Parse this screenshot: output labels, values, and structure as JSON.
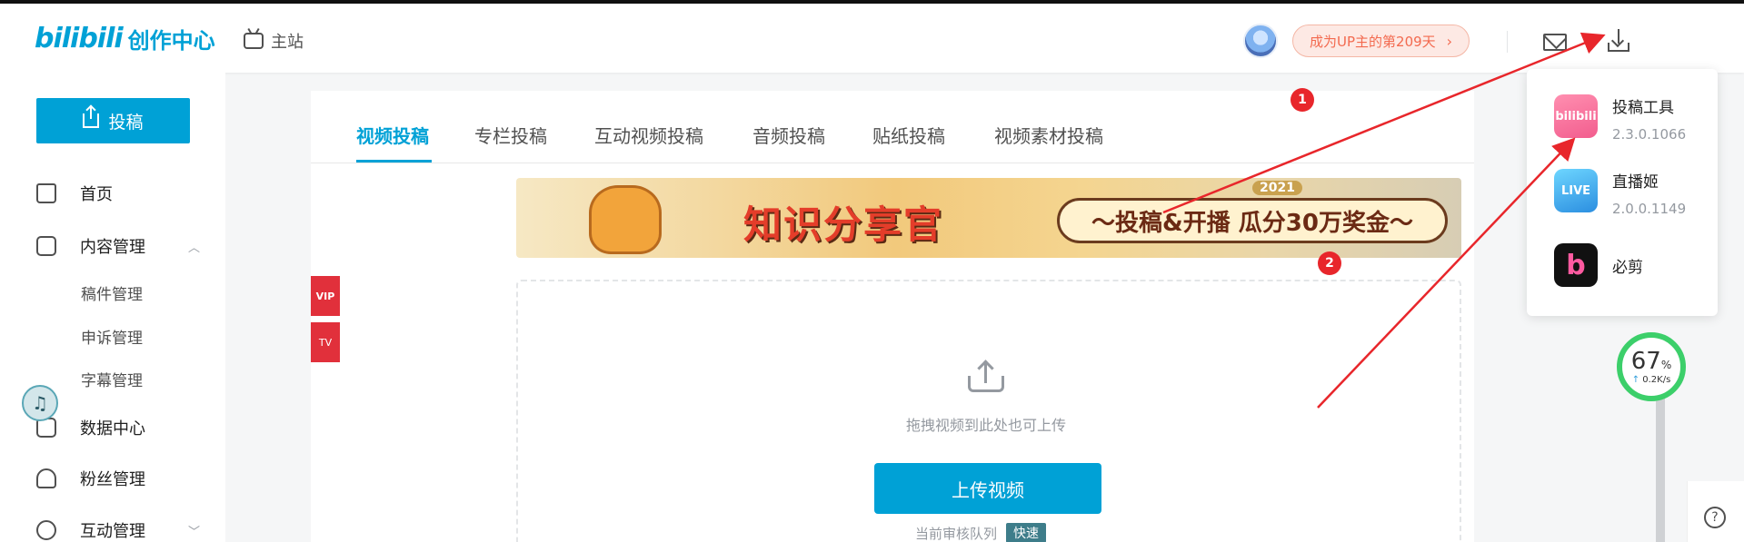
{
  "header": {
    "logo_text": "bilibili",
    "app_title": "创作中心",
    "home_link": "主站",
    "up_badge": "成为UP主的第209天"
  },
  "sidebar": {
    "upload_button": "投稿",
    "items": [
      {
        "label": "首页"
      },
      {
        "label": "内容管理"
      },
      {
        "label": "数据中心"
      },
      {
        "label": "粉丝管理"
      },
      {
        "label": "互动管理"
      }
    ],
    "sub_items": [
      {
        "label": "稿件管理"
      },
      {
        "label": "申诉管理"
      },
      {
        "label": "字幕管理"
      }
    ]
  },
  "tabs": [
    {
      "label": "视频投稿",
      "active": true
    },
    {
      "label": "专栏投稿"
    },
    {
      "label": "互动视频投稿"
    },
    {
      "label": "音频投稿"
    },
    {
      "label": "贴纸投稿"
    },
    {
      "label": "视频素材投稿"
    }
  ],
  "banner": {
    "title": "知识分享官",
    "slogan": "〜投稿&开播 瓜分30万奖金〜",
    "year": "2021"
  },
  "side_badges": {
    "vip": "VIP",
    "tv": "TV"
  },
  "upload_area": {
    "hint": "拖拽视频到此处也可上传",
    "button": "上传视频",
    "queue_label": "当前审核队列",
    "queue_status": "快速"
  },
  "download_menu": [
    {
      "name": "投稿工具",
      "version": "2.3.0.1066",
      "icon_text": "bilibili"
    },
    {
      "name": "直播姬",
      "version": "2.0.0.1149",
      "icon_text": "LIVE"
    },
    {
      "name": "必剪",
      "version": "",
      "icon_text": "b"
    }
  ],
  "speed_widget": {
    "percent": "67",
    "percent_unit": "%",
    "rate": "0.2K/s"
  },
  "annotations": {
    "dot1": "1",
    "dot2": "2",
    "color": "#e8262b"
  },
  "colors": {
    "brand": "#00a1d6",
    "badge_bg": "#fde9e4",
    "badge_text": "#f36a4f",
    "speed_ring": "#3ccf6a"
  }
}
